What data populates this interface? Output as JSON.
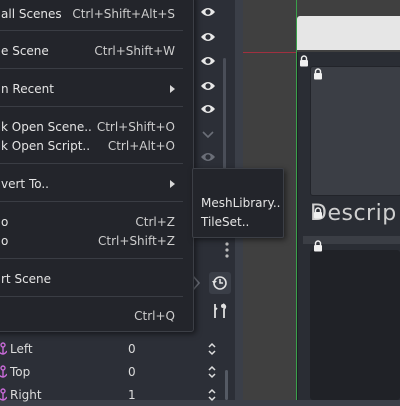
{
  "menu": {
    "items": [
      {
        "label": "all Scenes",
        "shortcut": "Ctrl+Shift+Alt+S"
      },
      {
        "label": "e Scene",
        "shortcut": "Ctrl+Shift+W"
      },
      {
        "label": "n Recent",
        "shortcut": ""
      },
      {
        "label": "k Open Scene..",
        "shortcut": "Ctrl+Shift+O"
      },
      {
        "label": "k Open Script..",
        "shortcut": "Ctrl+Alt+O"
      },
      {
        "label": "vert To..",
        "shortcut": ""
      },
      {
        "label": "o",
        "shortcut": "Ctrl+Z"
      },
      {
        "label": "o",
        "shortcut": "Ctrl+Shift+Z"
      },
      {
        "label": "rt Scene",
        "shortcut": ""
      },
      {
        "label": "",
        "shortcut": "Ctrl+Q"
      }
    ]
  },
  "submenu": {
    "items": [
      {
        "label": "MeshLibrary.."
      },
      {
        "label": "TileSet.."
      }
    ]
  },
  "viewport": {
    "label": "Descrip"
  },
  "inspector": {
    "properties": [
      {
        "name": "Left",
        "value": "0"
      },
      {
        "name": "Top",
        "value": "0"
      },
      {
        "name": "Right",
        "value": "1"
      }
    ]
  },
  "colors": {
    "menu_bg": "#23252b",
    "dock_bg": "#2c2f37",
    "guide_red": "#a03040",
    "guide_green": "#3aa04a",
    "anchor_icon": "#c76ad6"
  },
  "icons": [
    "eye-icon",
    "lock-icon",
    "history-icon",
    "tools-icon",
    "anchor-icon",
    "spin-arrows-icon",
    "submenu-arrow-icon"
  ]
}
